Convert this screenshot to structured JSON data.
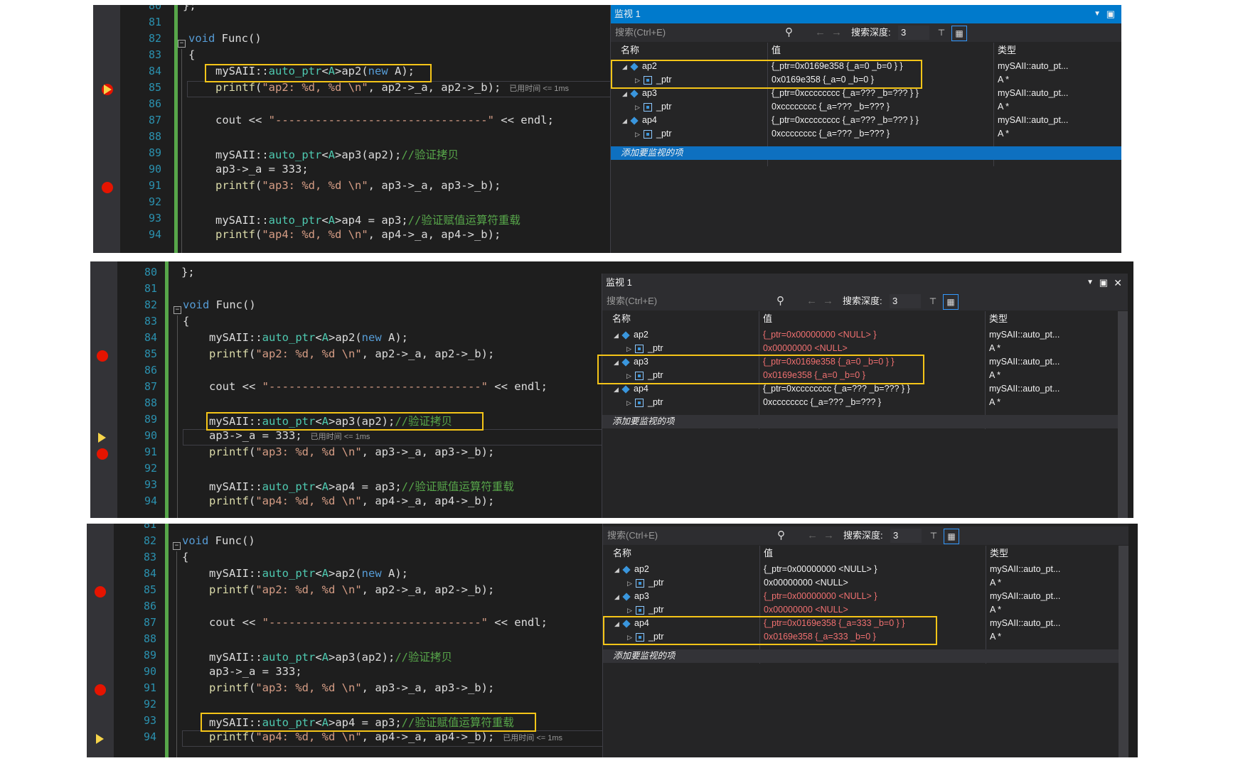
{
  "watch": {
    "title": "监视 1",
    "search_placeholder": "搜索(Ctrl+E)",
    "depth_label": "搜索深度:",
    "depth_value": "3",
    "col_name": "名称",
    "col_value": "值",
    "col_type": "类型",
    "add_item": "添加要监视的项"
  },
  "timing": "已用时间 <= 1ms",
  "lines": {
    "l80": "80",
    "l81": "81",
    "l82": "82",
    "l83": "83",
    "l84": "84",
    "l85": "85",
    "l86": "86",
    "l87": "87",
    "l88": "88",
    "l89": "89",
    "l90": "90",
    "l91": "91",
    "l92": "92",
    "l93": "93",
    "l94": "94"
  },
  "code": {
    "end_brace": "};",
    "void": "void",
    "func": " Func()",
    "open": "{",
    "ns": "mySAII::",
    "auto_ptr": "auto_ptr",
    "lt": "<",
    "A": "A",
    "gt": ">",
    "ap2_decl": "ap2(",
    "new": "new",
    "new_tail": " A);",
    "printf": "printf",
    "p2_str": "\"ap2: %d, %d \\n\"",
    "p2_tail": ", ap2->_a, ap2->_b);",
    "cout": "cout << ",
    "dash_str": "\"--------------------------------\"",
    "endl": " << endl;",
    "ap3_decl": "ap3(ap2);",
    "cm_copy": "//验证拷贝",
    "ap3_assign": "ap3->_a = 333;",
    "p3_str": "\"ap3: %d, %d \\n\"",
    "p3_tail": ", ap3->_a, ap3->_b);",
    "ap4_decl": "ap4 = ap3;",
    "cm_assign": "//验证赋值运算符重载",
    "p4_str": "\"ap4: %d, %d \\n\"",
    "p4_tail": ", ap4->_a, ap4->_b);"
  },
  "frames": [
    {
      "rows": [
        {
          "name": "ap2",
          "value": "{_ptr=0x0169e358 {_a=0 _b=0 } }",
          "type": "mySAII::auto_pt...",
          "red": false
        },
        {
          "name": "_ptr",
          "value": "0x0169e358 {_a=0 _b=0 }",
          "type": "A *",
          "red": false
        },
        {
          "name": "ap3",
          "value": "{_ptr=0xcccccccc {_a=??? _b=??? } }",
          "type": "mySAII::auto_pt...",
          "red": false
        },
        {
          "name": "_ptr",
          "value": "0xcccccccc {_a=??? _b=??? }",
          "type": "A *",
          "red": false
        },
        {
          "name": "ap4",
          "value": "{_ptr=0xcccccccc {_a=??? _b=??? } }",
          "type": "mySAII::auto_pt...",
          "red": false
        },
        {
          "name": "_ptr",
          "value": "0xcccccccc {_a=??? _b=??? }",
          "type": "A *",
          "red": false
        }
      ]
    },
    {
      "rows": [
        {
          "name": "ap2",
          "value": "{_ptr=0x00000000 <NULL> }",
          "type": "mySAII::auto_pt...",
          "red": true
        },
        {
          "name": "_ptr",
          "value": "0x00000000 <NULL>",
          "type": "A *",
          "red": true
        },
        {
          "name": "ap3",
          "value": "{_ptr=0x0169e358 {_a=0 _b=0 } }",
          "type": "mySAII::auto_pt...",
          "red": true
        },
        {
          "name": "_ptr",
          "value": "0x0169e358 {_a=0 _b=0 }",
          "type": "A *",
          "red": true
        },
        {
          "name": "ap4",
          "value": "{_ptr=0xcccccccc {_a=??? _b=??? } }",
          "type": "mySAII::auto_pt...",
          "red": false
        },
        {
          "name": "_ptr",
          "value": "0xcccccccc {_a=??? _b=??? }",
          "type": "A *",
          "red": false
        }
      ]
    },
    {
      "rows": [
        {
          "name": "ap2",
          "value": "{_ptr=0x00000000 <NULL> }",
          "type": "mySAII::auto_pt...",
          "red": false
        },
        {
          "name": "_ptr",
          "value": "0x00000000 <NULL>",
          "type": "A *",
          "red": false
        },
        {
          "name": "ap3",
          "value": "{_ptr=0x00000000 <NULL> }",
          "type": "mySAII::auto_pt...",
          "red": true
        },
        {
          "name": "_ptr",
          "value": "0x00000000 <NULL>",
          "type": "A *",
          "red": true
        },
        {
          "name": "ap4",
          "value": "{_ptr=0x0169e358 {_a=333 _b=0 } }",
          "type": "mySAII::auto_pt...",
          "red": true
        },
        {
          "name": "_ptr",
          "value": "0x0169e358 {_a=333 _b=0 }",
          "type": "A *",
          "red": true
        }
      ]
    }
  ],
  "colors": {
    "editor_bg": "#1e1e1e",
    "watch_bg": "#252526",
    "highlight_box": "#f5c518",
    "breakpoint": "#e51400",
    "selected_row": "#0e70c0"
  }
}
